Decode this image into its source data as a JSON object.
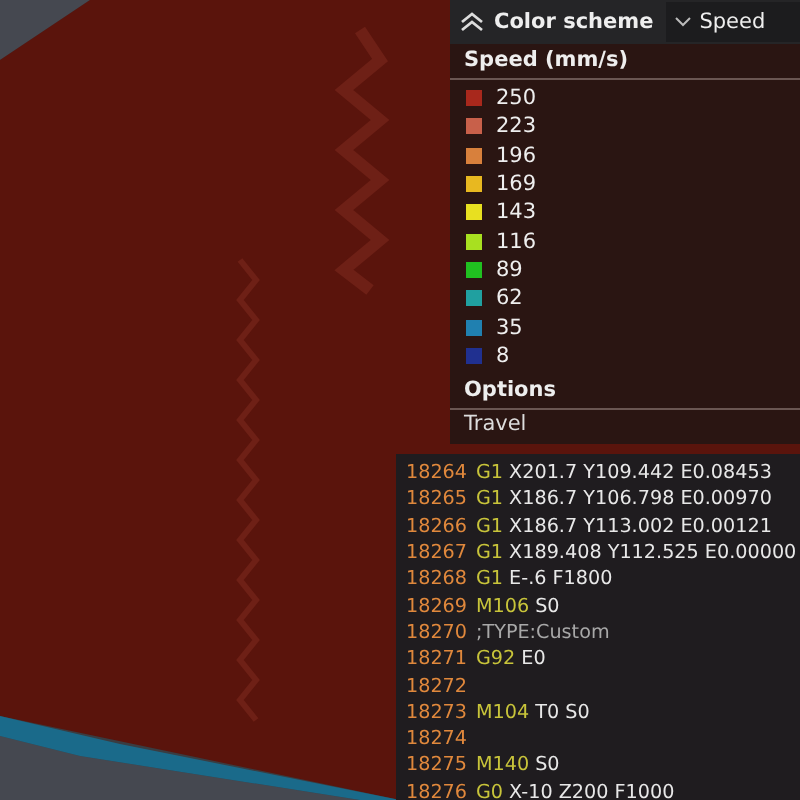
{
  "legend": {
    "title": "Color scheme",
    "scheme": "Speed",
    "heading": "Speed (mm/s)",
    "items": [
      {
        "label": "250",
        "color": "#a8281c"
      },
      {
        "label": "223",
        "color": "#c8604a"
      },
      {
        "label": "196",
        "color": "#d8803c"
      },
      {
        "label": "169",
        "color": "#e8b820"
      },
      {
        "label": "143",
        "color": "#e8e020"
      },
      {
        "label": "116",
        "color": "#a8e020"
      },
      {
        "label": "89",
        "color": "#20c020"
      },
      {
        "label": "62",
        "color": "#20a0a0"
      },
      {
        "label": "35",
        "color": "#2080b0"
      },
      {
        "label": "8",
        "color": "#203090"
      }
    ],
    "options_heading": "Options",
    "options": [
      "Travel"
    ]
  },
  "gcode": {
    "lines": [
      {
        "kind": "code",
        "number": "18264",
        "command": "G1",
        "args": "X201.7 Y109.442 E0.08453"
      },
      {
        "kind": "code",
        "number": "18265",
        "command": "G1",
        "args": "X186.7 Y106.798 E0.00970"
      },
      {
        "kind": "code",
        "number": "18266",
        "command": "G1",
        "args": "X186.7 Y113.002 E0.00121"
      },
      {
        "kind": "code",
        "number": "18267",
        "command": "G1",
        "args": "X189.408 Y112.525 E0.00000"
      },
      {
        "kind": "code",
        "number": "18268",
        "command": "G1",
        "args": "E-.6 F1800"
      },
      {
        "kind": "code",
        "number": "18269",
        "command": "M106",
        "args": "S0"
      },
      {
        "kind": "comment",
        "number": "18270",
        "text": ";TYPE:Custom"
      },
      {
        "kind": "code",
        "number": "18271",
        "command": "G92",
        "args": "E0"
      },
      {
        "kind": "empty",
        "number": "18272"
      },
      {
        "kind": "code",
        "number": "18273",
        "command": "M104",
        "args": "T0 S0"
      },
      {
        "kind": "empty",
        "number": "18274"
      },
      {
        "kind": "code",
        "number": "18275",
        "command": "M140",
        "args": "S0"
      },
      {
        "kind": "code",
        "number": "18276",
        "command": "G0",
        "args": "X-10 Z200 F1000"
      }
    ]
  }
}
